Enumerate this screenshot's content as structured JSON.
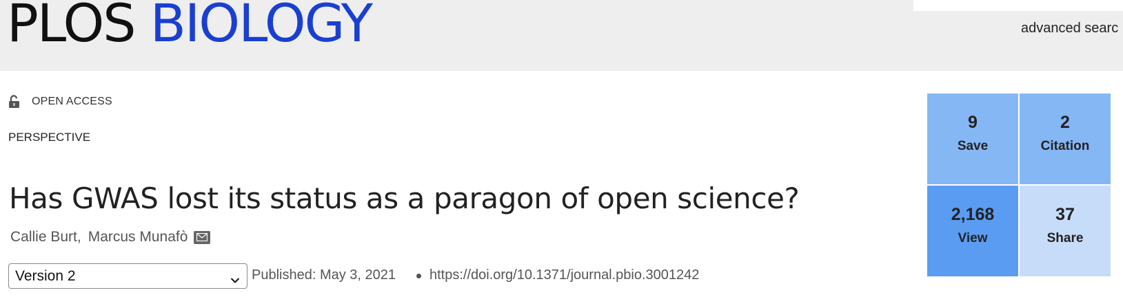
{
  "header": {
    "logo_part1": "PLOS",
    "logo_part2": "BIOLOGY",
    "advanced_search": "advanced searc"
  },
  "article": {
    "access_label": "OPEN ACCESS",
    "type": "PERSPECTIVE",
    "title": "Has GWAS lost its status as a paragon of open science?",
    "authors": [
      "Callie Burt,",
      "Marcus Munafò"
    ],
    "version_selected": "Version 2",
    "published": "Published: May 3, 2021",
    "doi": "https://doi.org/10.1371/journal.pbio.3001242"
  },
  "metrics": {
    "save": {
      "value": "9",
      "label": "Save"
    },
    "citation": {
      "value": "2",
      "label": "Citation"
    },
    "view": {
      "value": "2,168",
      "label": "View"
    },
    "share": {
      "value": "37",
      "label": "Share"
    }
  },
  "icons": {
    "access": "unlocked-padlock-icon",
    "email": "envelope-icon",
    "dropdown": "chevron-down-icon"
  },
  "colors": {
    "brand_blue": "#1a3fd0",
    "tile_save": "#86b7f5",
    "tile_citation": "#86b7f5",
    "tile_view": "#5a9cf2",
    "tile_share": "#c7dcf8"
  }
}
